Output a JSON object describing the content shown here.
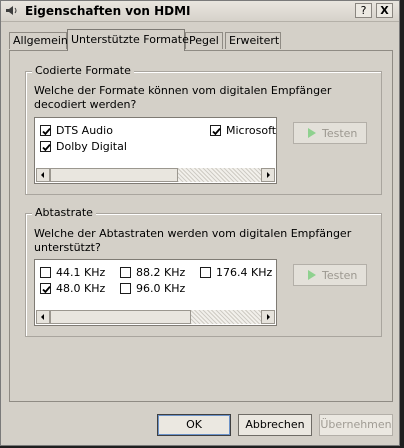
{
  "window": {
    "title": "Eigenschaften von HDMI"
  },
  "titlebar": {
    "help_label": "?",
    "close_label": "X"
  },
  "tabs": [
    {
      "label": "Allgemein"
    },
    {
      "label": "Unterstützte Formate"
    },
    {
      "label": "Pegel"
    },
    {
      "label": "Erweitert"
    }
  ],
  "coded_formats": {
    "legend": "Codierte Formate",
    "question": "Welche der Formate können vom digitalen Empfänger decodiert werden?",
    "items": [
      {
        "label": "DTS Audio",
        "checked": true
      },
      {
        "label": "Dolby Digital",
        "checked": true
      },
      {
        "label": "Microsoft",
        "checked": true
      }
    ],
    "test_label": "Testen"
  },
  "sample_rates": {
    "legend": "Abtastrate",
    "question": "Welche der Abtastraten werden vom digitalen Empfänger unterstützt?",
    "items": [
      {
        "label": "44.1 KHz",
        "checked": false
      },
      {
        "label": "88.2 KHz",
        "checked": false
      },
      {
        "label": "176.4 KHz",
        "checked": false
      },
      {
        "label": "48.0 KHz",
        "checked": true
      },
      {
        "label": "96.0 KHz",
        "checked": false
      }
    ],
    "test_label": "Testen"
  },
  "footer": {
    "ok_label": "OK",
    "cancel_label": "Abbrechen",
    "apply_label": "Übernehmen"
  },
  "colors": {
    "dialog_bg": "#d4d0c8",
    "play_icon": "#8fd18f"
  }
}
